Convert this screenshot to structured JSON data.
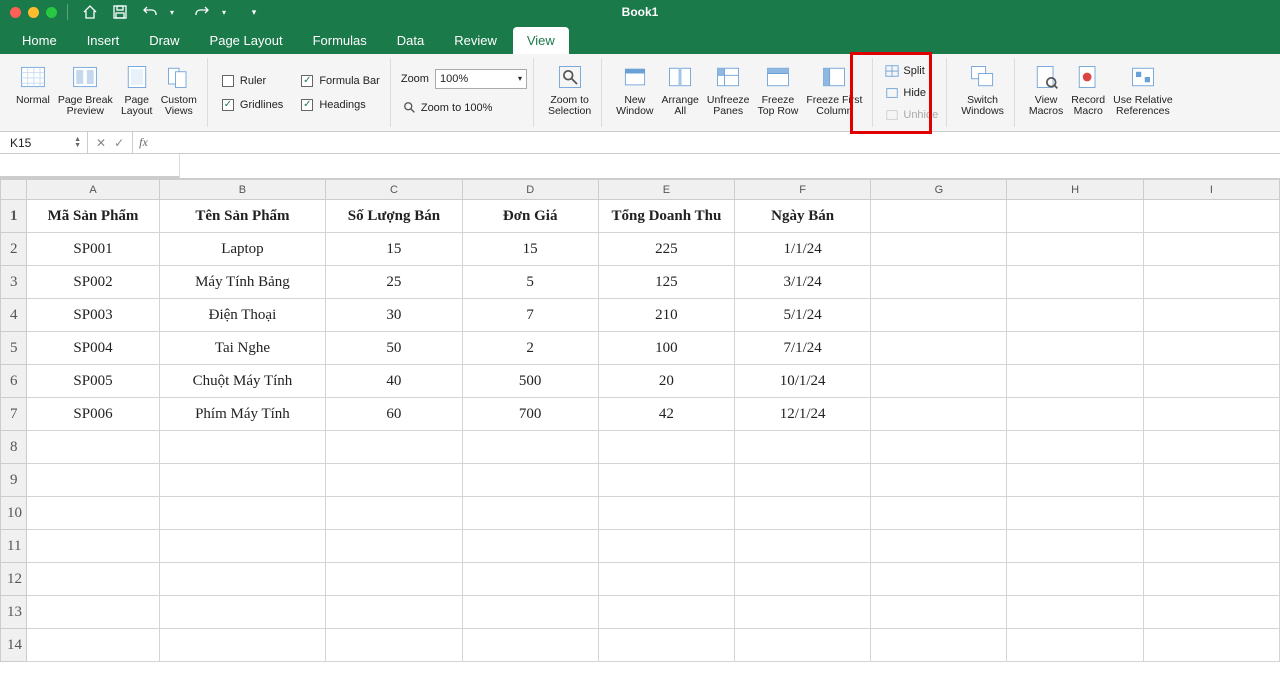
{
  "title": "Book1",
  "tabs": [
    "Home",
    "Insert",
    "Draw",
    "Page Layout",
    "Formulas",
    "Data",
    "Review",
    "View"
  ],
  "active_tab": "View",
  "ribbon": {
    "normal": "Normal",
    "page_break": "Page Break\nPreview",
    "page_layout": "Page\nLayout",
    "custom_views": "Custom\nViews",
    "ruler": "Ruler",
    "gridlines": "Gridlines",
    "formula_bar": "Formula Bar",
    "headings": "Headings",
    "zoom_label": "Zoom",
    "zoom_value": "100%",
    "zoom_to_100": "Zoom to 100%",
    "zoom_to_selection": "Zoom to\nSelection",
    "new_window": "New\nWindow",
    "arrange_all": "Arrange\nAll",
    "unfreeze_panes": "Unfreeze\nPanes",
    "freeze_top_row": "Freeze\nTop Row",
    "freeze_first_column": "Freeze First\nColumn",
    "split": "Split",
    "hide": "Hide",
    "unhide": "Unhide",
    "switch_windows": "Switch\nWindows",
    "view_macros": "View\nMacros",
    "record_macro": "Record\nMacro",
    "use_relative_refs": "Use Relative\nReferences"
  },
  "name_box": "K15",
  "fx_label": "fx",
  "columns": [
    "A",
    "B",
    "C",
    "D",
    "E",
    "F",
    "G",
    "H",
    "I"
  ],
  "headers": [
    "Mã Sản Phẩm",
    "Tên Sản Phẩm",
    "Số Lượng Bán",
    "Đơn Giá",
    "Tổng Doanh Thu",
    "Ngày Bán"
  ],
  "rows": [
    {
      "a": "SP001",
      "b": "Laptop",
      "c": "15",
      "d": "15",
      "e": "225",
      "f": "1/1/24"
    },
    {
      "a": "SP002",
      "b": "Máy Tính Bảng",
      "c": "25",
      "d": "5",
      "e": "125",
      "f": "3/1/24"
    },
    {
      "a": "SP003",
      "b": "Điện Thoại",
      "c": "30",
      "d": "7",
      "e": "210",
      "f": "5/1/24"
    },
    {
      "a": "SP004",
      "b": "Tai Nghe",
      "c": "50",
      "d": "2",
      "e": "100",
      "f": "7/1/24"
    },
    {
      "a": "SP005",
      "b": "Chuột Máy Tính",
      "c": "40",
      "d": "500",
      "e": "20",
      "f": "10/1/24"
    },
    {
      "a": "SP006",
      "b": "Phím Máy Tính",
      "c": "60",
      "d": "700",
      "e": "42",
      "f": "12/1/24"
    }
  ],
  "row_numbers": [
    "1",
    "2",
    "3",
    "4",
    "5",
    "6",
    "7",
    "8",
    "9",
    "10",
    "11",
    "12",
    "13",
    "14"
  ]
}
